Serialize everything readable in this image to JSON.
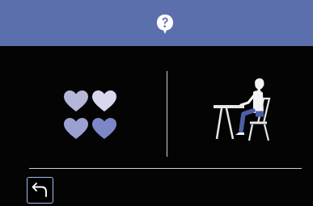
{
  "header": {
    "background": "#5c6fad",
    "help_icon": "question-bubble-icon"
  },
  "main": {
    "left_option_icon": "four-hearts-icon",
    "right_option_icon": "person-at-table-icon",
    "heart_colors": [
      "#b6b6d9",
      "#d7d7ed",
      "#9aa0d0",
      "#7d86c7"
    ]
  },
  "footer": {
    "back_icon": "back-arrow-icon",
    "accent": "#a8b8f0"
  }
}
